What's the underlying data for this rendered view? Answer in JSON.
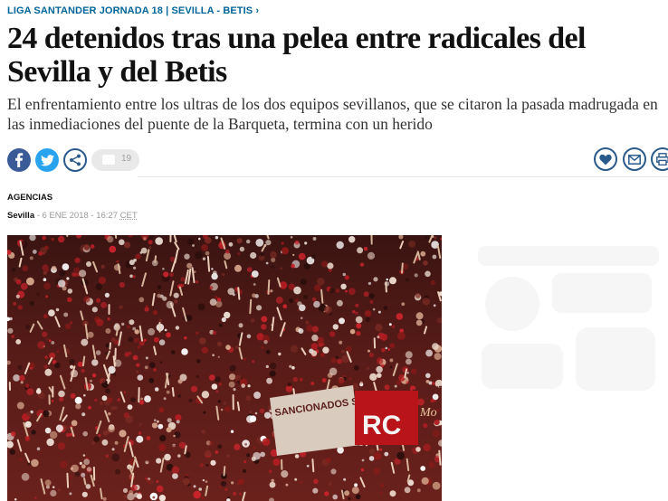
{
  "breadcrumb": {
    "section": "LIGA SANTANDER JORNADA 18",
    "separator": "|",
    "tag": "SEVILLA - BETIS",
    "arrow": "›"
  },
  "article": {
    "title": "24 detenidos tras una pelea entre radicales del Sevilla y del Betis",
    "subtitle": "El enfrentamiento entre los ultras de los dos equipos sevillanos, que se citaron la pasada madrugada en las inmediaciones del puente de la Barqueta, termina con un herido",
    "author": "AGENCIAS",
    "city": "Sevilla",
    "date": "- 6 ENE 2018 - 16:27",
    "timezone": "CET"
  },
  "share": {
    "comment_count": "19",
    "icons": [
      "facebook-icon",
      "twitter-icon",
      "share-icon",
      "comment-icon",
      "heart-icon",
      "mail-icon",
      "print-icon"
    ]
  },
  "photo": {
    "banner_text": "SANCIONADOS SIEMPRE PRESENTES",
    "flag_text": "RC",
    "flag_text_2": "Mo"
  },
  "colors": {
    "kicker": "#006599",
    "facebook": "#3a5a98",
    "twitter": "#2aa3ef",
    "icon_outline": "#2a5a8c"
  }
}
